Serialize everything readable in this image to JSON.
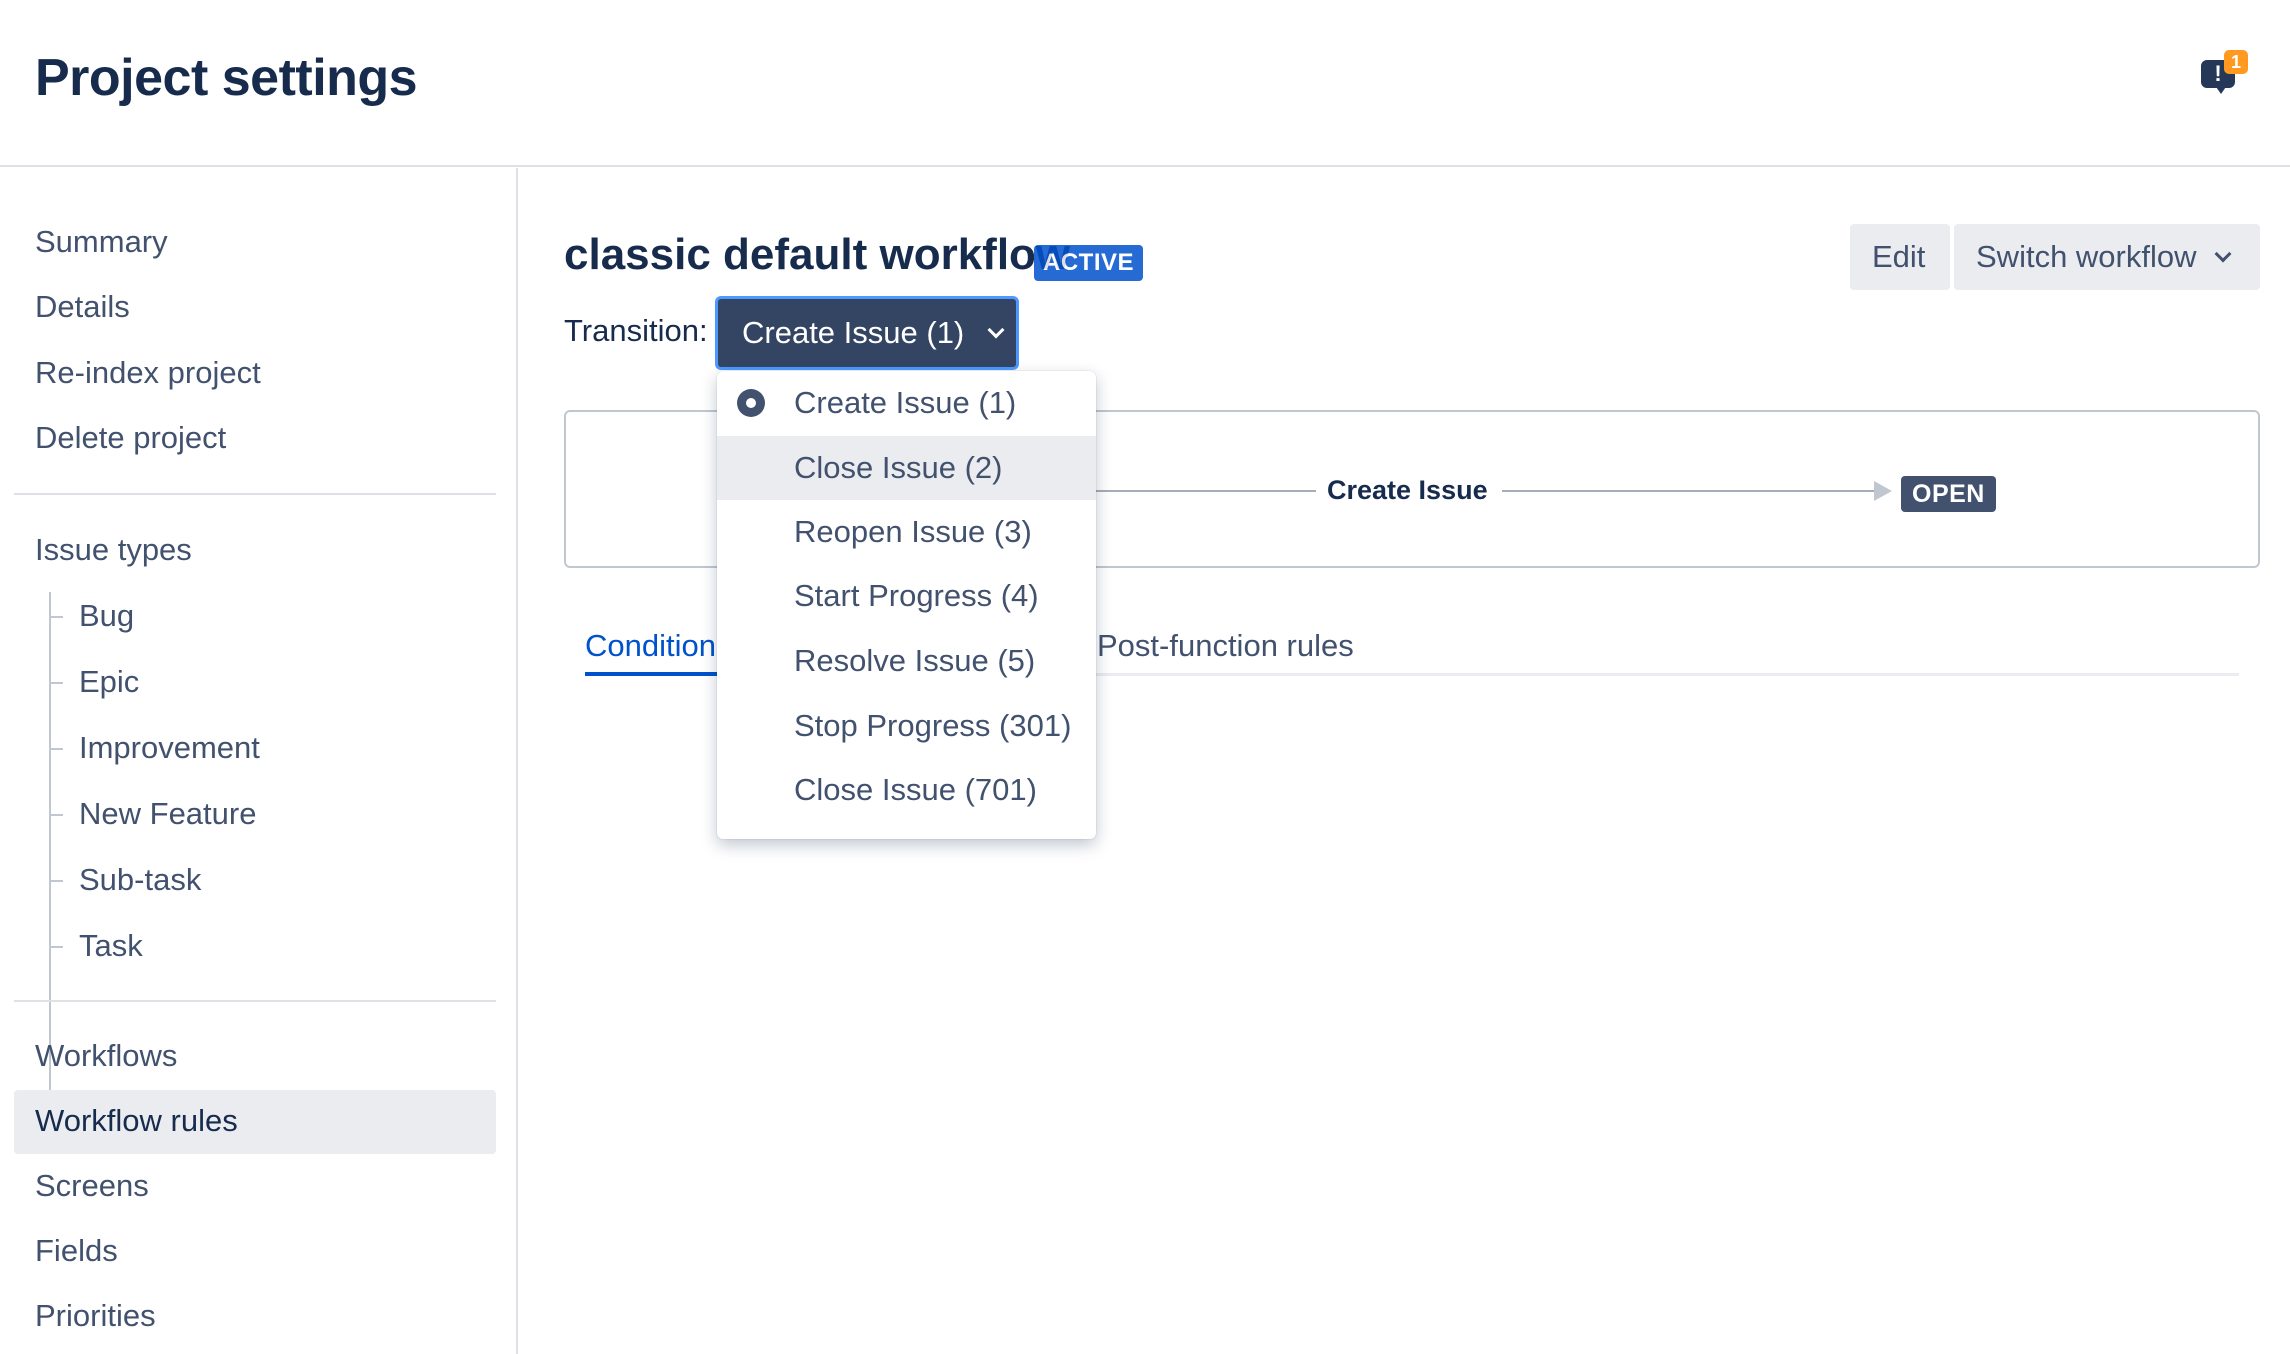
{
  "header": {
    "title": "Project settings",
    "notifications_count": "1",
    "notifications_icon": "feedback-icon",
    "notifications_glyph": "!"
  },
  "sidebar": {
    "items_top": [
      "Summary",
      "Details",
      "Re-index project",
      "Delete project"
    ],
    "issue_types_label": "Issue types",
    "issue_types": [
      "Bug",
      "Epic",
      "Improvement",
      "New Feature",
      "Sub-task",
      "Task"
    ],
    "items_bottom": [
      "Workflows",
      "Workflow rules",
      "Screens",
      "Fields",
      "Priorities"
    ],
    "selected": "Workflow rules"
  },
  "workflow": {
    "title": "classic default workflow",
    "status_lozenge": "ACTIVE",
    "edit_label": "Edit",
    "switch_label": "Switch workflow",
    "transition_label": "Transition:",
    "selected_transition": "Create Issue (1)"
  },
  "diagram": {
    "transition_name": "Create Issue",
    "target_status": "OPEN"
  },
  "tabs": {
    "conditions": "Condition",
    "post_functions": "Post-function rules"
  },
  "dropdown": {
    "options": [
      "Create Issue (1)",
      "Close Issue (2)",
      "Reopen Issue (3)",
      "Start Progress (4)",
      "Resolve Issue (5)",
      "Stop Progress (301)",
      "Close Issue (701)"
    ],
    "selected_index": 0,
    "hovered_index": 1
  },
  "colors": {
    "primary_text": "#172b4d",
    "secondary_text": "#42526e",
    "link_blue": "#0052cc",
    "selected_bg": "#ebecf0",
    "dark_button": "#344563",
    "badge_orange": "#ff991f"
  }
}
